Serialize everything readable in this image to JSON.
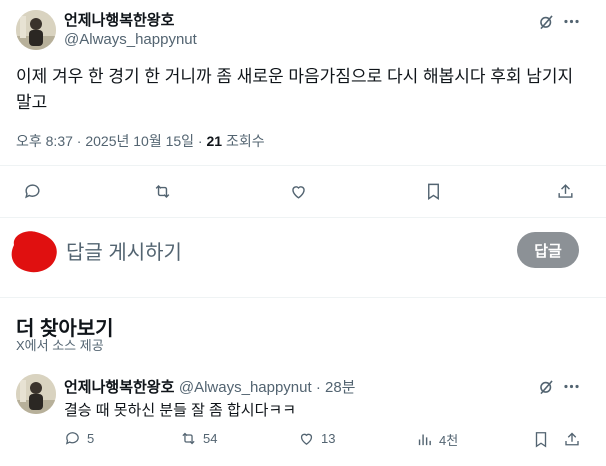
{
  "tweet": {
    "display_name": "언제나행복한왕호",
    "handle": "@Always_happynut",
    "text": "이제 겨우 한 경기 한 거니까 좀 새로운 마음가짐으로 다시 해봅시다 후회 남기지말고",
    "time": "오후 8:37 · 2025년 10월 15일 · ",
    "views_count": "21",
    "views_label": " 조회수"
  },
  "reply_box": {
    "placeholder": "답글 게시하기",
    "button_label": "답글"
  },
  "more": {
    "title": "더 찾아보기",
    "subtitle": "X에서 소스 제공"
  },
  "related_tweet": {
    "display_name": "언제나행복한왕호",
    "handle": "@Always_happynut",
    "age": " · 28분",
    "text": "결승 때 못하신 분들 잘 좀 합시다ㅋㅋ",
    "replies": "5",
    "retweets": "54",
    "likes": "13",
    "views": "4천"
  },
  "icons": {
    "grok": "grok-icon",
    "more": "more-icon",
    "reply": "reply-icon",
    "retweet": "retweet-icon",
    "like": "heart-icon",
    "bookmark": "bookmark-icon",
    "share": "share-icon",
    "views": "views-icon"
  },
  "colors": {
    "text_primary": "#0f1419",
    "text_secondary": "#536471",
    "reply_button": "#8c9196",
    "user_avatar_blob": "#e01010"
  }
}
